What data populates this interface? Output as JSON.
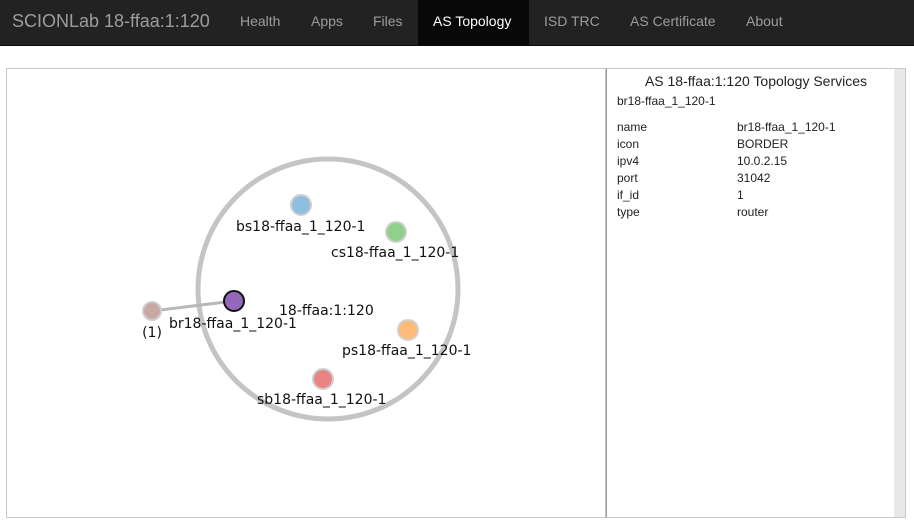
{
  "navbar": {
    "brand": "SCIONLab 18-ffaa:1:120",
    "items": [
      {
        "label": "Health",
        "active": false
      },
      {
        "label": "Apps",
        "active": false
      },
      {
        "label": "Files",
        "active": false
      },
      {
        "label": "AS Topology",
        "active": true
      },
      {
        "label": "ISD TRC",
        "active": false
      },
      {
        "label": "AS Certificate",
        "active": false
      },
      {
        "label": "About",
        "active": false
      }
    ]
  },
  "graph": {
    "as_label": "18-ffaa:1:120",
    "link_label": "(1)",
    "nodes": [
      {
        "name": "bs18-ffaa_1_120-1",
        "color": "#8fbfe0",
        "icon": "beacon-service-node"
      },
      {
        "name": "cs18-ffaa_1_120-1",
        "color": "#8fd18c",
        "icon": "certificate-service-node"
      },
      {
        "name": "br18-ffaa_1_120-1",
        "color": "#9467bd",
        "icon": "border-router-node",
        "selected": true
      },
      {
        "name": "ps18-ffaa_1_120-1",
        "color": "#ffbb78",
        "icon": "path-service-node"
      },
      {
        "name": "sb18-ffaa_1_120-1",
        "color": "#e98484",
        "icon": "sibra-service-node"
      }
    ],
    "colors": {
      "as_circle": "#c4c4c4",
      "remote_node": "#c9a8a4",
      "link": "#b8b8b8",
      "selected_stroke": "#111111"
    }
  },
  "side_panel": {
    "title": "AS 18-ffaa:1:120 Topology Services",
    "selected": "br18-ffaa_1_120-1",
    "properties": [
      {
        "key": "name",
        "value": "br18-ffaa_1_120-1"
      },
      {
        "key": "icon",
        "value": "BORDER"
      },
      {
        "key": "ipv4",
        "value": "10.0.2.15"
      },
      {
        "key": "port",
        "value": "31042"
      },
      {
        "key": "if_id",
        "value": "1"
      },
      {
        "key": "type",
        "value": "router"
      }
    ]
  }
}
